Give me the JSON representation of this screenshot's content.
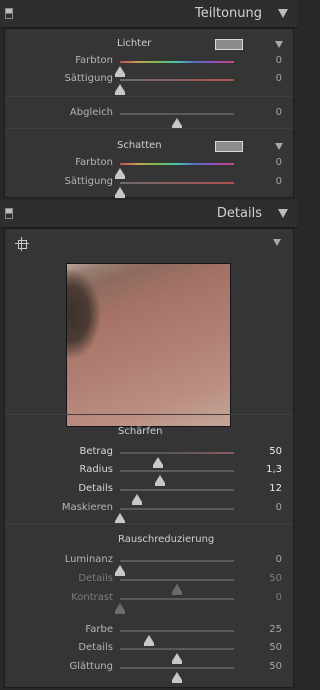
{
  "split_toning": {
    "title": "Teiltonung",
    "highlights": {
      "label": "Lichter",
      "hue": {
        "label": "Farbton",
        "value": "0",
        "fraction": 0.0
      },
      "saturation": {
        "label": "Sättigung",
        "value": "0",
        "fraction": 0.0
      }
    },
    "balance": {
      "label": "Abgleich",
      "value": "0",
      "fraction": 0.5
    },
    "shadows": {
      "label": "Schatten",
      "hue": {
        "label": "Farbton",
        "value": "0",
        "fraction": 0.0
      },
      "saturation": {
        "label": "Sättigung",
        "value": "0",
        "fraction": 0.0
      }
    }
  },
  "details": {
    "title": "Details",
    "sharpening": {
      "label": "Schärfen",
      "amount": {
        "label": "Betrag",
        "value": "50",
        "fraction": 0.33
      },
      "radius": {
        "label": "Radius",
        "value": "1,3",
        "fraction": 0.35
      },
      "detail": {
        "label": "Details",
        "value": "12",
        "fraction": 0.15
      },
      "masking": {
        "label": "Maskieren",
        "value": "0",
        "fraction": 0.0
      }
    },
    "noise_reduction": {
      "label": "Rauschreduzierung",
      "luminance": {
        "label": "Luminanz",
        "value": "0",
        "fraction": 0.0
      },
      "lum_detail": {
        "label": "Details",
        "value": "50",
        "fraction": 0.5
      },
      "lum_contrast": {
        "label": "Kontrast",
        "value": "0",
        "fraction": 0.0
      },
      "color": {
        "label": "Farbe",
        "value": "25",
        "fraction": 0.25
      },
      "color_detail": {
        "label": "Details",
        "value": "50",
        "fraction": 0.5
      },
      "smoothness": {
        "label": "Glättung",
        "value": "50",
        "fraction": 0.5
      }
    }
  }
}
